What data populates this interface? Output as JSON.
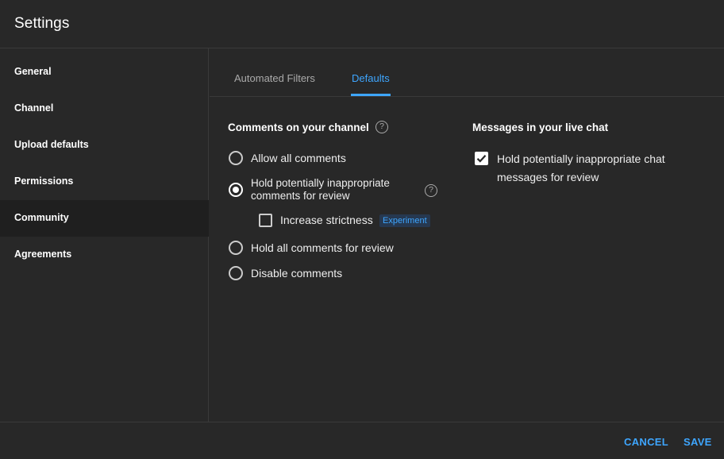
{
  "header": {
    "title": "Settings"
  },
  "sidebar": {
    "items": [
      {
        "label": "General"
      },
      {
        "label": "Channel"
      },
      {
        "label": "Upload defaults"
      },
      {
        "label": "Permissions"
      },
      {
        "label": "Community",
        "active": true
      },
      {
        "label": "Agreements"
      }
    ]
  },
  "tabs": [
    {
      "label": "Automated Filters"
    },
    {
      "label": "Defaults",
      "active": true
    }
  ],
  "comments": {
    "title": "Comments on your channel",
    "help": "?",
    "options": [
      {
        "label": "Allow all comments",
        "checked": false
      },
      {
        "label": "Hold potentially inappropriate comments for review",
        "label_line1": "Hold potentially inappropriate",
        "label_line2": "comments for review",
        "checked": true
      },
      {
        "label": "Hold all comments for review",
        "checked": false
      },
      {
        "label": "Disable comments",
        "checked": false
      }
    ],
    "strictness": {
      "label": "Increase strictness",
      "badge": "Experiment",
      "checked": false
    }
  },
  "live_chat": {
    "title": "Messages in your live chat",
    "option": {
      "label_line1": "Hold potentially inappropriate chat",
      "label_line2": "messages for review",
      "checked": true
    }
  },
  "footer": {
    "cancel": "CANCEL",
    "save": "SAVE"
  },
  "colors": {
    "accent": "#3ea6ff",
    "background": "#282828",
    "active_nav": "#1f1f1f"
  }
}
